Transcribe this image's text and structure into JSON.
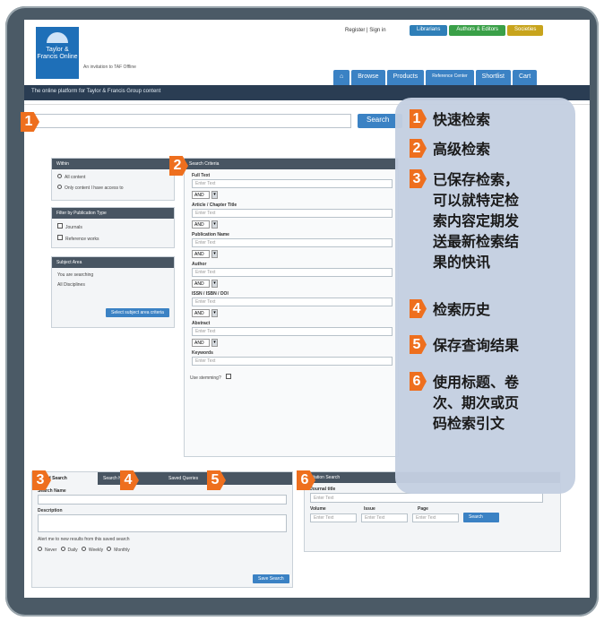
{
  "header": {
    "logo_text": "Taylor & Francis Online",
    "sub_tagline": "An invitation to TAF Offline",
    "top_links": "Register | Sign in",
    "pills": [
      {
        "label": "Librarians",
        "color": "#2f7fb8"
      },
      {
        "label": "Authors & Editors",
        "color": "#3aa048"
      },
      {
        "label": "Societies",
        "color": "#c8a41c"
      }
    ],
    "nav": [
      "⌂",
      "Browse",
      "Products",
      "Reference Center",
      "Shortlist",
      "Cart"
    ],
    "site_tagline": "The online platform for Taylor & Francis Group content"
  },
  "search": {
    "button": "Search"
  },
  "panels": {
    "within": {
      "title": "Within",
      "opt1": "All content",
      "opt2": "Only content I have access to"
    },
    "pubtype": {
      "title": "Filter by Publication Type",
      "opt1": "Journals",
      "opt2": "Reference works"
    },
    "subject": {
      "title": "Subject Area",
      "line1": "You are searching",
      "line2": "All Disciplines",
      "button": "Select subject area criteria"
    }
  },
  "criteria": {
    "title": "Search Criteria",
    "fields": [
      "Full Text",
      "Article / Chapter Title",
      "Publication Name",
      "Author",
      "ISSN / ISBN / DOI",
      "Abstract",
      "Keywords"
    ],
    "placeholder": "Enter Text",
    "and": "AND",
    "stemming": "Use stemming?"
  },
  "saved": {
    "tabs": [
      "Saved Search",
      "Search History",
      "Saved Queries"
    ],
    "name_label": "Search Name",
    "desc_label": "Description",
    "alert_label": "Alert me to new results from this saved search",
    "freq": [
      "Never",
      "Daily",
      "Weekly",
      "Monthly"
    ],
    "button": "Save Search"
  },
  "citation": {
    "title": "Citation Search",
    "journal_label": "Journal title",
    "volume": "Volume",
    "issue": "Issue",
    "page": "Page",
    "placeholder": "Enter Text",
    "button": "Search"
  },
  "overlay": {
    "items": [
      {
        "num": "1",
        "text": "快速检索"
      },
      {
        "num": "2",
        "text": "高级检索"
      },
      {
        "num": "3",
        "text": "已保存检索，\n可以就特定检\n索内容定期发\n送最新检索结\n果的快讯"
      },
      {
        "num": "4",
        "text": "检索历史"
      },
      {
        "num": "5",
        "text": "保存查询结果"
      },
      {
        "num": "6",
        "text": "使用标题、卷\n次、期次或页\n码检索引文"
      }
    ]
  },
  "badges": [
    "1",
    "2",
    "3",
    "4",
    "5",
    "6"
  ]
}
